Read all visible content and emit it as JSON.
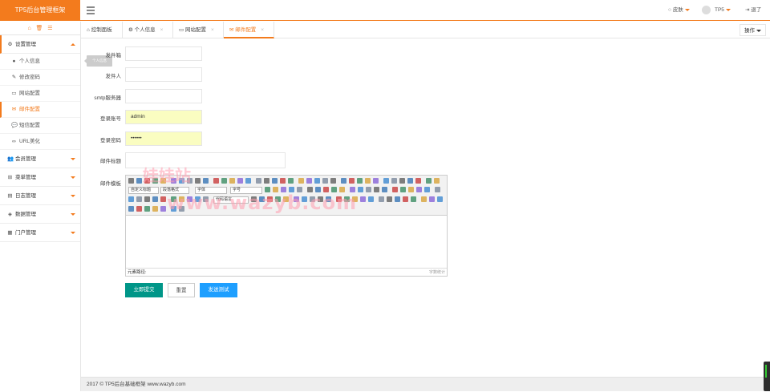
{
  "header": {
    "logo": "TP5后台管理框架",
    "skin": "皮肤",
    "user": "TP5",
    "logout": "退了"
  },
  "sidebar": {
    "top_icons": [
      "home-icon",
      "trash-icon",
      "list-icon"
    ],
    "groups": [
      {
        "label": "设置管理",
        "icon": "cogs-icon",
        "expanded": true,
        "items": [
          {
            "label": "个人信息",
            "icon": "user-icon"
          },
          {
            "label": "修改密码",
            "icon": "edit-icon"
          },
          {
            "label": "网站配置",
            "icon": "desktop-icon"
          },
          {
            "label": "邮件配置",
            "icon": "envelope-icon",
            "active": true
          },
          {
            "label": "短信配置",
            "icon": "comment-icon"
          },
          {
            "label": "URL美化",
            "icon": "link-icon"
          }
        ]
      },
      {
        "label": "会员管理",
        "icon": "users-icon"
      },
      {
        "label": "菜单管理",
        "icon": "sitemap-icon"
      },
      {
        "label": "日志管理",
        "icon": "book-icon"
      },
      {
        "label": "数据管理",
        "icon": "cubes-icon"
      },
      {
        "label": "门户管理",
        "icon": "th-icon"
      }
    ],
    "tooltip": "个人信息"
  },
  "tabs": [
    {
      "label": "控制面板",
      "icon": "home-icon",
      "closable": false
    },
    {
      "label": "个人信息",
      "icon": "gear-icon",
      "closable": true
    },
    {
      "label": "网站配置",
      "icon": "desktop-icon",
      "closable": true
    },
    {
      "label": "邮件配置",
      "icon": "envelope-icon",
      "closable": true,
      "active": true
    }
  ],
  "ops_label": "操作",
  "form": {
    "sender_email_label": "发件箱",
    "sender_name_label": "发件人",
    "smtp_label": "smtp服务器",
    "account_label": "登录账号",
    "account_value": "admin",
    "password_label": "登录密码",
    "password_value": "••••••",
    "subject_label": "邮件标题",
    "template_label": "邮件模板"
  },
  "editor": {
    "selects": [
      "自定义标题",
      "段落格式",
      "字体",
      "字号",
      "代码语言"
    ],
    "path_label": "元素路径:",
    "word_count": "字数统计"
  },
  "buttons": {
    "submit": "立即提交",
    "reset": "重置",
    "test": "发送测试"
  },
  "watermark": {
    "cn": "娃娃站",
    "url": "www.wazyb.com"
  },
  "footer": "2017 © TP5后台基础框架 www.wazyb.com",
  "colors": {
    "accent": "#f37b1d",
    "submit": "#009688",
    "test": "#1e9fff"
  }
}
